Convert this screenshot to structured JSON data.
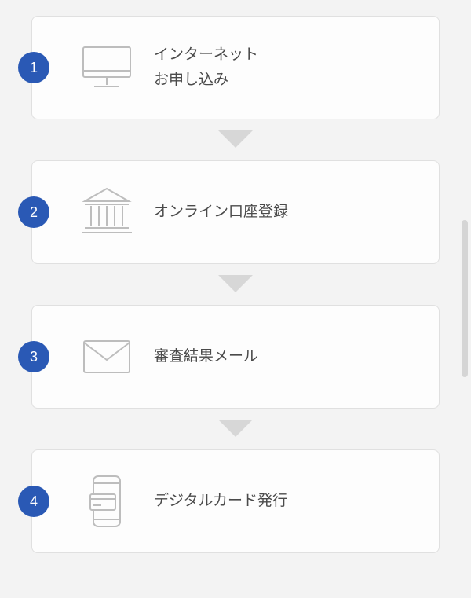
{
  "colors": {
    "badge_bg": "#2a59b5",
    "badge_text": "#ffffff",
    "card_bg": "#fdfdfd",
    "card_border": "#e0e0e0",
    "icon_stroke": "#bdbdbd",
    "label_text": "#4a4a4a",
    "arrow_fill": "#d7d7d7",
    "page_bg": "#f3f3f3"
  },
  "steps": [
    {
      "number": "1",
      "icon": "monitor-icon",
      "label": "インターネット\nお申し込み"
    },
    {
      "number": "2",
      "icon": "bank-icon",
      "label": "オンライン口座登録"
    },
    {
      "number": "3",
      "icon": "mail-icon",
      "label": "審査結果メール"
    },
    {
      "number": "4",
      "icon": "digital-card-icon",
      "label": "デジタルカード発行"
    }
  ]
}
